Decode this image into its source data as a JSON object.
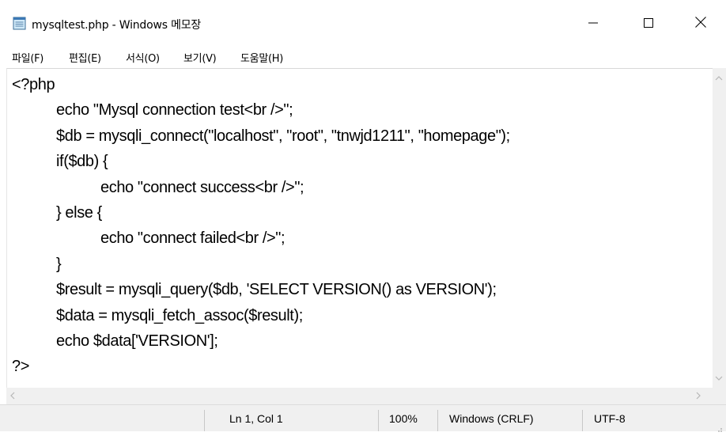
{
  "window": {
    "title": "mysqltest.php - Windows 메모장",
    "icon": "notepad-icon",
    "controls": {
      "minimize_icon": "minimize-icon",
      "maximize_icon": "maximize-icon",
      "close_icon": "close-icon"
    }
  },
  "menu": {
    "items": [
      "파일(F)",
      "편집(E)",
      "서식(O)",
      "보기(V)",
      "도움말(H)"
    ]
  },
  "editor": {
    "lines": [
      "<?php",
      "echo \"Mysql connection test<br />\";",
      "$db = mysqli_connect(\"localhost\", \"root\", \"tnwjd1211\", \"homepage\");",
      "if($db) {",
      "echo \"connect success<br />\";",
      "} else {",
      "echo \"connect failed<br />\";",
      "}",
      "$result = mysqli_query($db, 'SELECT VERSION() as VERSION');",
      "$data = mysqli_fetch_assoc($result);",
      "echo $data['VERSION'];",
      "?>"
    ]
  },
  "statusbar": {
    "position": "Ln 1, Col 1",
    "zoom": "100%",
    "line_ending": "Windows (CRLF)",
    "encoding": "UTF-8"
  }
}
